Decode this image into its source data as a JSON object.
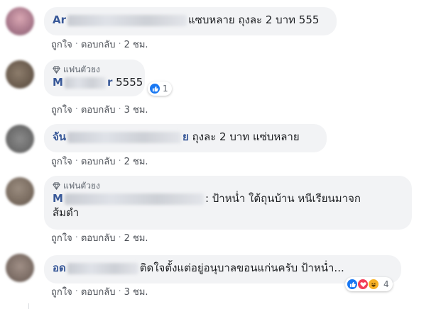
{
  "comments": [
    {
      "fan_badge": "",
      "name_visible": "Ar",
      "text": "แซบหลาย ถุงละ 2 บาท 555",
      "actions": {
        "like": "ถูกใจ",
        "reply": "ตอบกลับ",
        "time": "2 ชม."
      },
      "reactions": null
    },
    {
      "fan_badge": "แฟนตัวยง",
      "name_visible": "M",
      "name_tail": "r",
      "text": "5555",
      "actions": {
        "like": "ถูกใจ",
        "reply": "ตอบกลับ",
        "time": "3 ชม."
      },
      "reactions": {
        "count": "1",
        "types": [
          "like"
        ]
      }
    },
    {
      "fan_badge": "",
      "name_visible": "จัน",
      "name_tail": "ย",
      "text": "ถุงละ 2 บาท แซ่บหลาย",
      "actions": {
        "like": "ถูกใจ",
        "reply": "ตอบกลับ",
        "time": "2 ชม."
      },
      "reactions": null
    },
    {
      "fan_badge": "แฟนตัวยง",
      "name_visible": "M",
      "text": ": ป้าหน่ำ ใต้ถุนบ้าน หนีเรียนมาจก",
      "text_line2": "ส้มตำ",
      "actions": {
        "like": "ถูกใจ",
        "reply": "ตอบกลับ",
        "time": "2 ชม."
      },
      "reactions": null
    },
    {
      "fan_badge": "",
      "name_visible": "อด",
      "text": "ติดใจตั้งแต่อยู่อนุบาลขอนแก่นครับ ป้าหน่ำ...",
      "actions": {
        "like": "ถูกใจ",
        "reply": "ตอบกลับ",
        "time": "3 ชม."
      },
      "reactions": {
        "count": "4",
        "types": [
          "like",
          "love",
          "haha"
        ]
      }
    }
  ],
  "colors": {
    "name": "#385898",
    "bubble": "#f2f3f5",
    "like": "#1877f2",
    "love": "#f33e58",
    "haha": "#f7b125"
  }
}
